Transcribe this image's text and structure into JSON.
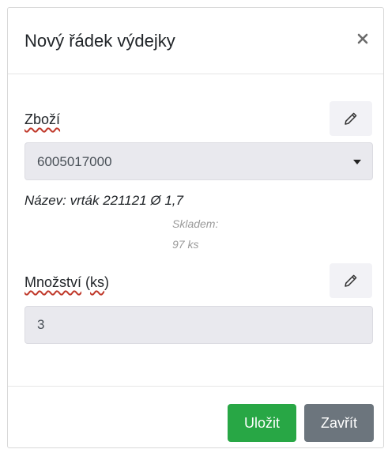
{
  "dialog": {
    "title": "Nový řádek výdejky",
    "close_symbol": "×"
  },
  "goods": {
    "label": "Zboží",
    "edit_icon": "pencil-icon",
    "selected_value": "6005017000",
    "name_text": "Název: vrták 221121 Ø 1,7",
    "stock_label": "Skladem:",
    "stock_value": "97 ks"
  },
  "quantity": {
    "label_part1": "Množství",
    "label_part2": "(",
    "label_part3": "ks",
    "label_part4": ")",
    "edit_icon": "pencil-icon",
    "value": "3"
  },
  "footer": {
    "save_label": "Uložit",
    "close_label": "Zavřít"
  },
  "colors": {
    "save": "#28a745",
    "close": "#6c757d",
    "spellcheck_underline": "#c0392b"
  }
}
